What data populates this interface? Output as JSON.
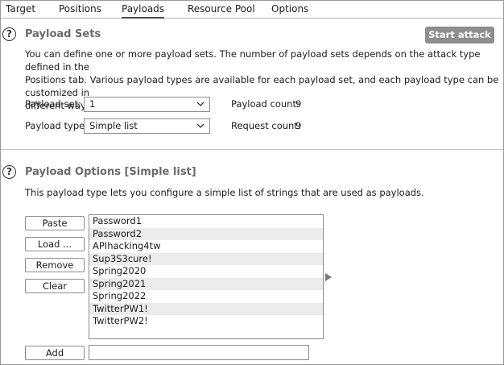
{
  "tabs": [
    {
      "label": "Target"
    },
    {
      "label": "Positions"
    },
    {
      "label": "Payloads"
    },
    {
      "label": "Resource Pool"
    },
    {
      "label": "Options"
    }
  ],
  "active_tab": "Payloads",
  "payload_sets": {
    "help_glyph": "?",
    "title": "Payload Sets",
    "start_button": "Start attack",
    "description_lines": [
      "You can define one or more payload sets. The number of payload sets depends on the attack type defined in the",
      "Positions tab. Various payload types are available for each payload set, and each payload type can be customized in",
      "different ways."
    ],
    "set_label": "Payload set:",
    "set_value": "1",
    "type_label": "Payload type:",
    "type_value": "Simple list",
    "payload_count_label": "Payload count:",
    "payload_count": "9",
    "request_count_label": "Request count:",
    "request_count": "9"
  },
  "payload_options": {
    "help_glyph": "?",
    "title": "Payload Options [Simple list]",
    "description": "This payload type lets you configure a simple list of strings that are used as payloads.",
    "buttons": {
      "paste": "Paste",
      "load": "Load ...",
      "remove": "Remove",
      "clear": "Clear",
      "add": "Add"
    },
    "items": [
      "Password1",
      "Password2",
      "APIhacking4tw",
      "Sup3S3cure!",
      "Spring2020",
      "Spring2021",
      "Spring2022",
      "TwitterPW1!",
      "TwitterPW2!"
    ],
    "add_value": ""
  },
  "colors": {
    "start_button_bg": "#8e8e8e",
    "section_title": "#6b6b6b",
    "row_alt": "#ececec"
  },
  "icons": {
    "help": "question-circle-icon",
    "dropdown": "chevron-down-icon",
    "move": "arrow-right-icon"
  }
}
